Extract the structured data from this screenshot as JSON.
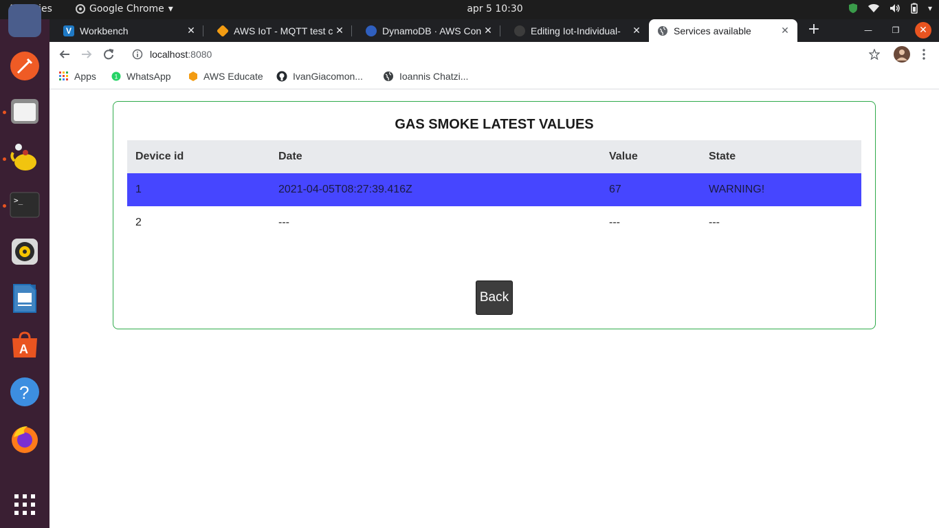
{
  "system": {
    "activities": "Activities",
    "app_name": "Google Chrome",
    "clock": "apr 5  10:30"
  },
  "tabs": [
    {
      "title": "Workbench",
      "icon": "vscode-icon"
    },
    {
      "title": "AWS IoT - MQTT test cl",
      "icon": "aws-icon"
    },
    {
      "title": "DynamoDB · AWS Con",
      "icon": "dynamodb-icon"
    },
    {
      "title": "Editing Iot-Individual-",
      "icon": "github-icon"
    },
    {
      "title": "Services available",
      "icon": "globe-icon",
      "active": true
    }
  ],
  "address": {
    "host": "localhost",
    "port": ":8080"
  },
  "bookmarks": [
    {
      "label": "Apps",
      "icon": "apps-grid-icon"
    },
    {
      "label": "WhatsApp",
      "icon": "whatsapp-icon"
    },
    {
      "label": "AWS Educate",
      "icon": "aws-icon"
    },
    {
      "label": "IvanGiacomon...",
      "icon": "github-icon"
    },
    {
      "label": "Ioannis Chatzi...",
      "icon": "globe-icon"
    }
  ],
  "page": {
    "title": "GAS SMOKE LATEST VALUES",
    "columns": [
      "Device id",
      "Date",
      "Value",
      "State"
    ],
    "rows": [
      {
        "device_id": "1",
        "date": "2021-04-05T08:27:39.416Z",
        "value": "67",
        "state": "WARNING!",
        "highlight": true
      },
      {
        "device_id": "2",
        "date": "---",
        "value": "---",
        "state": "---",
        "highlight": false
      }
    ],
    "back_label": "Back"
  },
  "colors": {
    "warning_row": "#4646ff",
    "panel_border": "#2eaa4a",
    "ubuntu_orange": "#e95420"
  }
}
